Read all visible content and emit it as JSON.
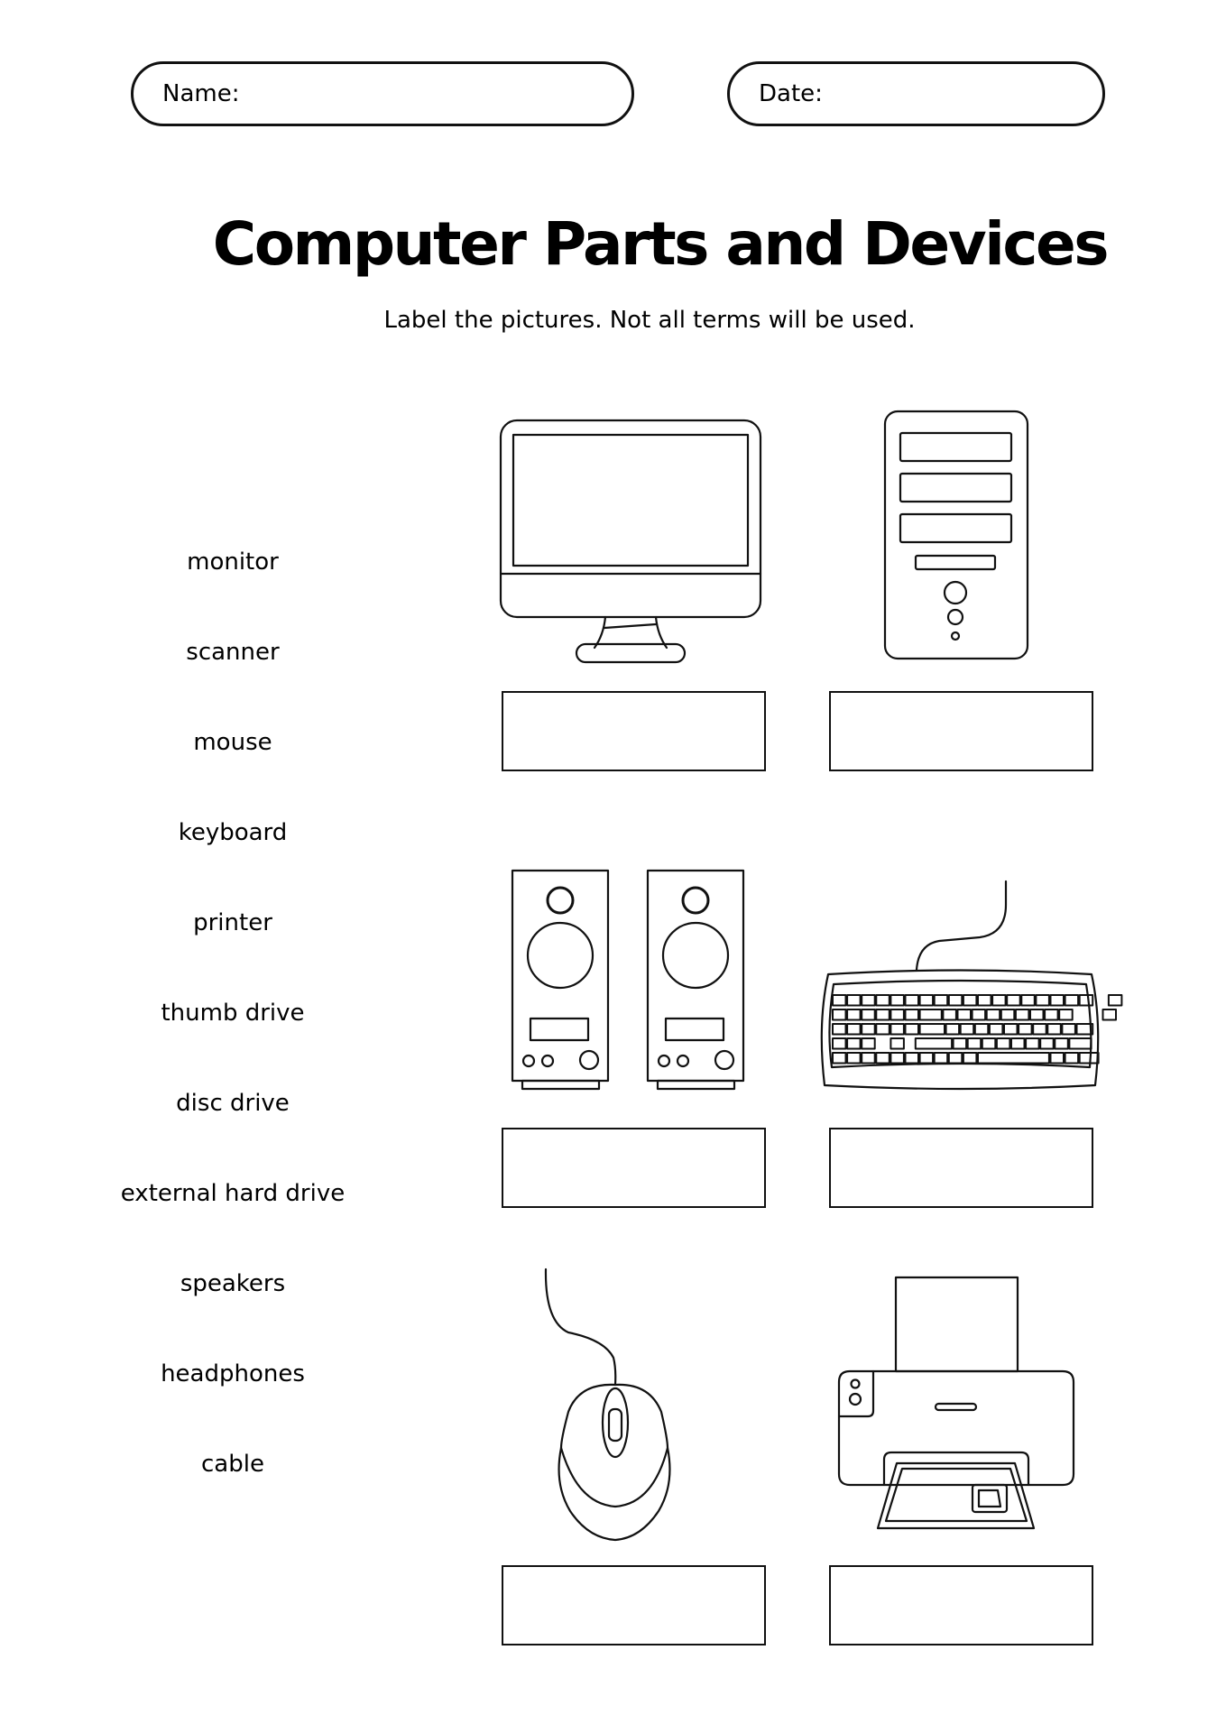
{
  "header": {
    "name_label": "Name:",
    "date_label": "Date:"
  },
  "title": "Computer Parts and Devices",
  "instructions": "Label the pictures. Not all terms will be used.",
  "word_bank": [
    "monitor",
    "scanner",
    "mouse",
    "keyboard",
    "printer",
    "thumb drive",
    "disc drive",
    "external hard drive",
    "speakers",
    "headphones",
    "cable"
  ],
  "pictures": [
    {
      "icon": "monitor-icon",
      "answer": ""
    },
    {
      "icon": "computer-tower-icon",
      "answer": ""
    },
    {
      "icon": "speakers-icon",
      "answer": ""
    },
    {
      "icon": "keyboard-icon",
      "answer": ""
    },
    {
      "icon": "mouse-icon",
      "answer": ""
    },
    {
      "icon": "printer-icon",
      "answer": ""
    }
  ]
}
